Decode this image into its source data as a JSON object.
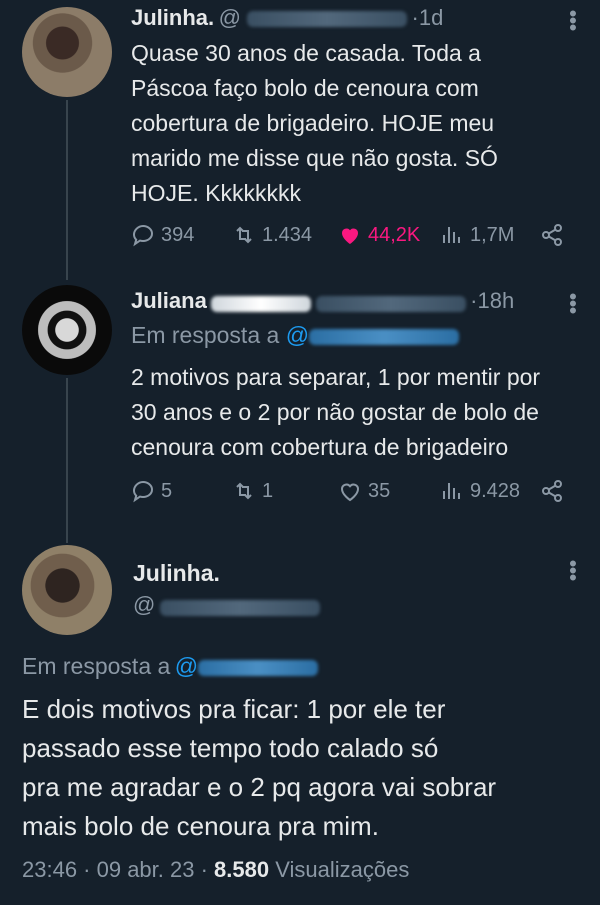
{
  "tweet1": {
    "name": "Julinha.",
    "handle_prefix": "@",
    "sep": "·",
    "time": "1d",
    "text": "Quase 30 anos de casada. Toda a\nPáscoa faço bolo de cenoura com\ncobertura de brigadeiro. HOJE meu\nmarido me disse que não gosta. SÓ\nHOJE. Kkkkkkkk",
    "replies": "394",
    "retweets": "1.434",
    "likes": "44,2K",
    "views": "1,7M",
    "like_color": "#f91880"
  },
  "tweet2": {
    "name": "Juliana",
    "sep": "·",
    "time": "18h",
    "reply_label": "Em resposta a",
    "reply_at": "@",
    "text": "2 motivos para separar, 1 por mentir por\n30 anos e o 2 por não gostar de bolo de\ncenoura com cobertura de brigadeiro",
    "replies": "5",
    "retweets": "1",
    "likes": "35",
    "views": "9.428"
  },
  "tweet3": {
    "name": "Julinha.",
    "handle_prefix": "@",
    "reply_label": "Em resposta a",
    "reply_at": "@",
    "text": "E dois motivos pra ficar: 1 por ele ter\npassado esse tempo todo calado só\npra me agradar e o 2 pq agora vai sobrar\nmais bolo de cenoura pra mim.",
    "timestamp": "23:46 · 09 abr. 23 ·",
    "view_count": "8.580",
    "view_label": "Visualizações"
  },
  "colors": {
    "background": "#15202b",
    "text": "#e7e9ea",
    "muted": "#8b98a5",
    "link": "#1d9bf0",
    "like": "#f91880"
  },
  "icons": [
    "reply-icon",
    "retweet-icon",
    "heart-icon",
    "views-icon",
    "share-icon",
    "more-icon"
  ]
}
